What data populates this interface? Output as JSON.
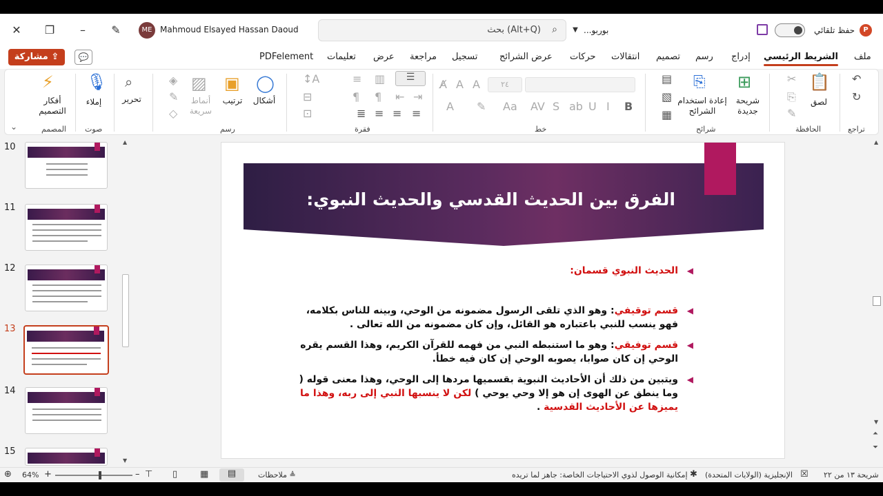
{
  "title_bar": {
    "user_name": "Mahmoud Elsayed Hassan Daoud",
    "user_initials": "ME",
    "search_placeholder": "بحث (Alt+Q)",
    "document_name": "بوربو...",
    "autosave_label": "حفظ تلقائي"
  },
  "tabs": {
    "items": [
      "ملف",
      "الشريط الرئيسي",
      "إدراج",
      "رسم",
      "تصميم",
      "انتقالات",
      "حركات",
      "عرض الشرائح",
      "تسجيل",
      "مراجعة",
      "عرض",
      "تعليمات",
      "PDFelement"
    ],
    "active": "الشريط الرئيسي",
    "share_label": "مشاركة"
  },
  "ribbon": {
    "groups": {
      "undo": "تراجع",
      "clipboard": "الحافظة",
      "slides": "شرائح",
      "font": "خط",
      "paragraph": "فقرة",
      "drawing": "رسم",
      "voice": "صوت",
      "designer": "المصمم"
    },
    "buttons": {
      "paste": "لصق",
      "new_slide_line1": "شريحة",
      "new_slide_line2": "جديدة",
      "reuse_line1": "إعادة استخدام",
      "reuse_line2": "الشرائح",
      "shapes": "أشكال",
      "arrange": "ترتيب",
      "quick_styles_line1": "أنماط",
      "quick_styles_line2": "سريعة",
      "editing": "تحرير",
      "dictate": "إملاء",
      "designer_line1": "أفكار",
      "designer_line2": "التصميم"
    },
    "font_size": "٢٤"
  },
  "thumbnails": {
    "numbers": [
      "10",
      "11",
      "12",
      "13",
      "14",
      "15"
    ],
    "selected": "13"
  },
  "slide": {
    "title": "الفرق بين الحديث القدسي والحديث النبوي:",
    "bullet1": "الحديث النبوي قسمان:",
    "bullet2_red": "قسم توقيفي",
    "bullet2_text": ": وهو الذي تلقى الرسول مضمونه من الوحي، وبينه للناس بكلامه، فهو ينسب للنبي باعتباره هو القائل، وإن كان مضمونه من الله تعالى .",
    "bullet3_red": "قسم توفيقي",
    "bullet3_text": ": وهو ما استنبطه النبي من فهمه للقرآن الكريم، وهذا القسم يقره الوحي إن كان صوابا، يصوبه الوحي إن كان فيه خطأ.",
    "bullet4_text": "ويتبين من ذلك أن الأحاديث النبوية بقسميها مردها إلى الوحي، وهذا معنى قوله ( وما ينطق عن الهوى إن هو إلا وحي يوحي ) ",
    "bullet4_red": "لكن لا ينسبها النبي إلى ربه، وهذا ما يميزها عن الأحاديث القدسية",
    "bullet4_end": " ."
  },
  "status_bar": {
    "slide_counter": "شريحة ١٣ من ٢٢",
    "language": "الإنجليزية (الولايات المتحدة)",
    "accessibility": "إمكانية الوصول لذوي الاحتياجات الخاصة: جاهز لما تريده",
    "notes": "ملاحظات",
    "zoom": "64%"
  },
  "colors": {
    "accent": "#c43e1c",
    "slide_pink": "#b0195f",
    "title_band": "#5a2b5e",
    "bullet_red": "#d11010"
  }
}
